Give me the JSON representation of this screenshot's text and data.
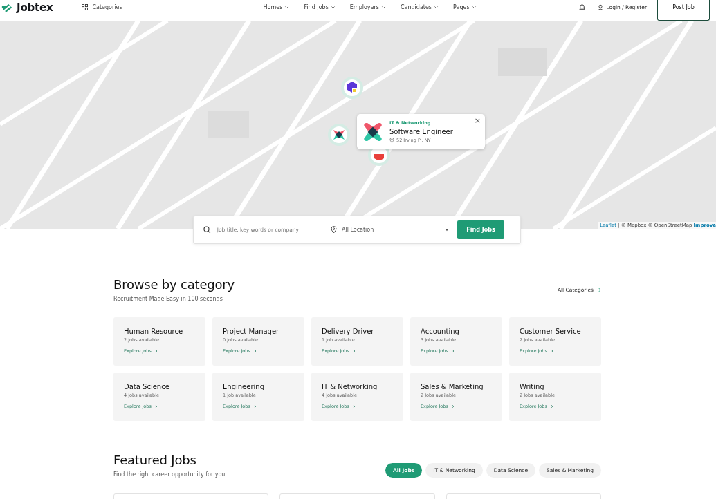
{
  "header": {
    "logo": "Jobtex",
    "categories": "Categories",
    "nav": [
      {
        "label": "Homes"
      },
      {
        "label": "Find Jobs"
      },
      {
        "label": "Employers"
      },
      {
        "label": "Candidates"
      },
      {
        "label": "Pages"
      }
    ],
    "login": "Login / Register",
    "post_job": "Post Job"
  },
  "map": {
    "popup": {
      "category": "IT & Networking",
      "title": "Software Engineer",
      "location": "52 Irving Pl, NY",
      "close": "×"
    },
    "attribution": {
      "leaflet": "Leaflet",
      "rest": "| © Mapbox © OpenStreetMap",
      "improve": "Improve"
    }
  },
  "search": {
    "placeholder": "Job title, key words or company",
    "location": "All Location",
    "button": "Find Jobs"
  },
  "browse": {
    "title": "Browse by category",
    "subtitle": "Recruitment Made Easy in 100 seconds",
    "all_link": "All Categories",
    "categories": [
      {
        "name": "Human Resource",
        "count": "2 Jobs available",
        "link": "Explore Jobs"
      },
      {
        "name": "Project Manager",
        "count": "0 Jobs available",
        "link": "Explore Jobs"
      },
      {
        "name": "Delivery Driver",
        "count": "1 Job available",
        "link": "Explore Jobs"
      },
      {
        "name": "Accounting",
        "count": "3 Jobs available",
        "link": "Explore Jobs"
      },
      {
        "name": "Customer Service",
        "count": "2 Jobs available",
        "link": "Explore Jobs"
      },
      {
        "name": "Data Science",
        "count": "4 Jobs available",
        "link": "Explore Jobs"
      },
      {
        "name": "Engineering",
        "count": "1 Job available",
        "link": "Explore Jobs"
      },
      {
        "name": "IT & Networking",
        "count": "4 Jobs available",
        "link": "Explore Jobs"
      },
      {
        "name": "Sales & Marketing",
        "count": "2 Jobs available",
        "link": "Explore Jobs"
      },
      {
        "name": "Writing",
        "count": "2 Jobs available",
        "link": "Explore Jobs"
      }
    ]
  },
  "featured": {
    "title": "Featured Jobs",
    "subtitle": "Find the right career opportunity for you",
    "tabs": [
      {
        "label": "All Jobs",
        "selected": true
      },
      {
        "label": "IT & Networking",
        "selected": false
      },
      {
        "label": "Data Science",
        "selected": false
      },
      {
        "label": "Sales & Marketing",
        "selected": false
      }
    ]
  }
}
